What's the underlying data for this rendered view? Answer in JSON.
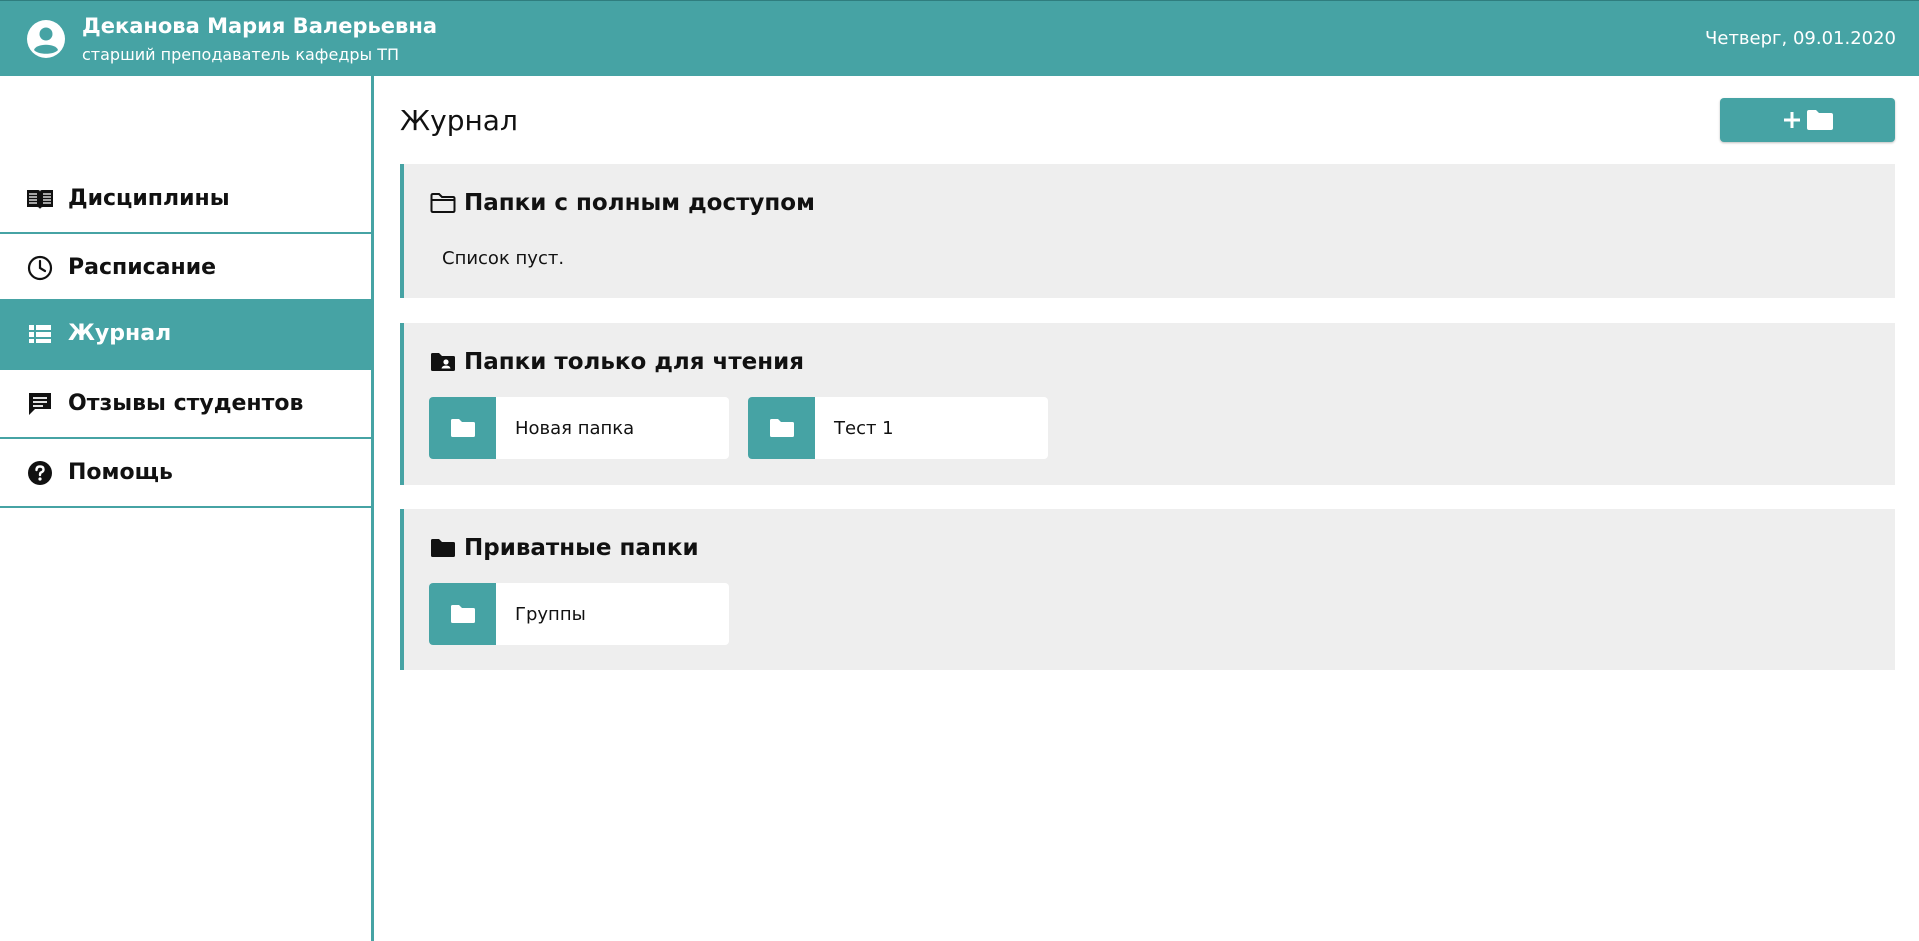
{
  "header": {
    "user_name": "Деканова Мария Валерьевна",
    "user_role": "старший преподаватель кафедры ТП",
    "date": "Четверг, 09.01.2020",
    "avatar_icon": "user-circle-icon"
  },
  "sidebar": {
    "items": [
      {
        "label": "Дисциплины",
        "icon": "book-open-icon",
        "active": false
      },
      {
        "label": "Расписание",
        "icon": "clock-icon",
        "active": false
      },
      {
        "label": "Журнал",
        "icon": "list-icon",
        "active": true
      },
      {
        "label": "Отзывы студентов",
        "icon": "comment-icon",
        "active": false
      },
      {
        "label": "Помощь",
        "icon": "question-circle-icon",
        "active": false
      }
    ]
  },
  "main": {
    "title": "Журнал",
    "add_folder_button": {
      "icons": [
        "plus-icon",
        "folder-icon"
      ]
    },
    "sections": [
      {
        "title": "Папки с полным доступом",
        "icon": "folder-outline-icon",
        "empty_text": "Список пуст.",
        "folders": []
      },
      {
        "title": "Папки только для чтения",
        "icon": "folder-user-icon",
        "folders": [
          {
            "label": "Новая папка"
          },
          {
            "label": "Тест 1"
          }
        ]
      },
      {
        "title": "Приватные папки",
        "icon": "folder-icon",
        "folders": [
          {
            "label": "Группы"
          }
        ]
      }
    ]
  },
  "colors": {
    "accent": "#46a3a4",
    "section_bg": "#eeeeee",
    "text": "#111111"
  }
}
